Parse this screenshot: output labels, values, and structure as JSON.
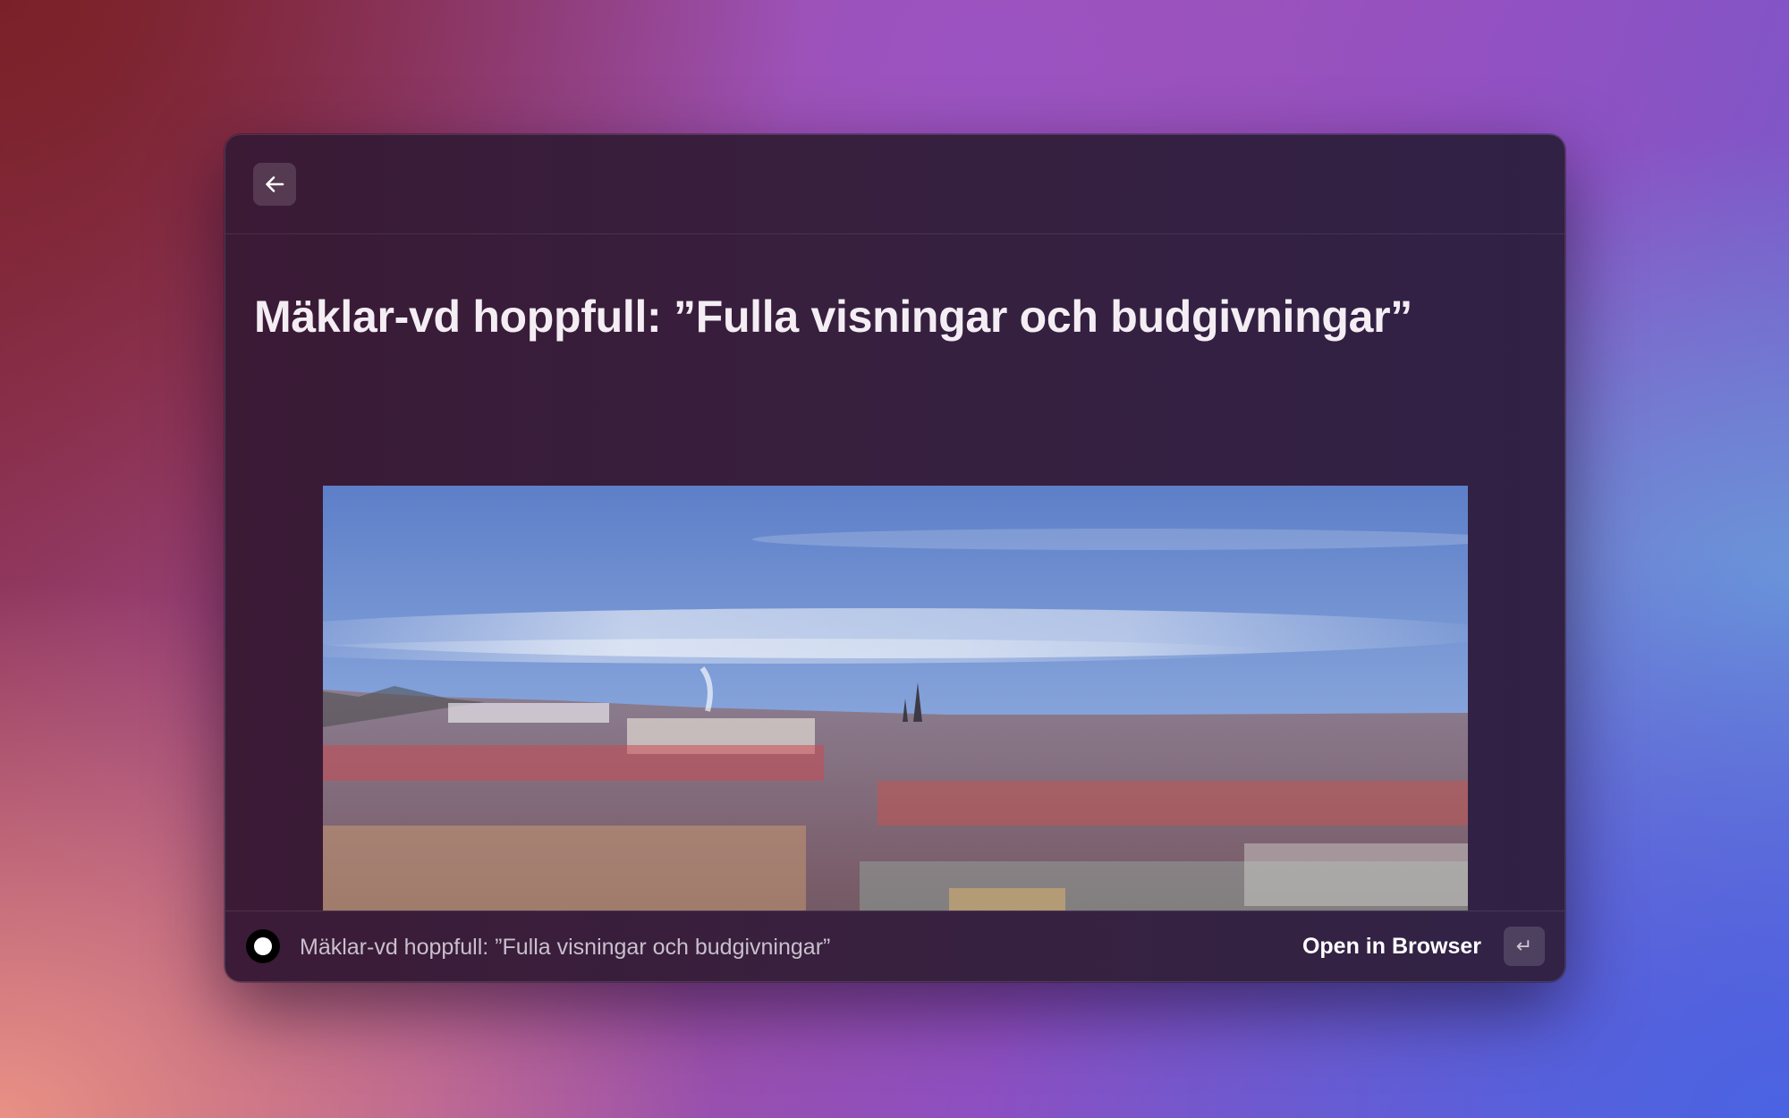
{
  "header": {
    "back_icon": "arrow-left-icon"
  },
  "article": {
    "title": "Mäklar-vd hoppfull: ”Fulla visningar och budgivningar”",
    "image": {
      "subject": "panoramic-city-skyline"
    }
  },
  "footer": {
    "favicon_icon": "source-favicon-icon",
    "title": "Mäklar-vd hoppfull: ”Fulla visningar och budgivningar”",
    "action_label": "Open in Browser",
    "action_key_icon": "return-key-icon",
    "action_key_glyph": "↵"
  }
}
